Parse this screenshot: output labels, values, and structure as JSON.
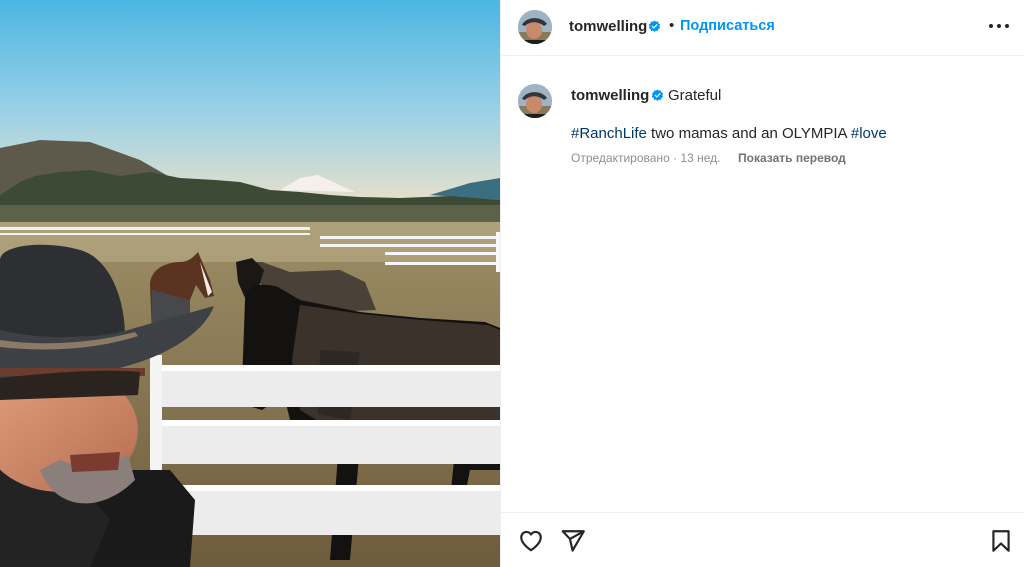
{
  "post": {
    "author": {
      "username": "tomwelling",
      "verified": true,
      "avatar_icon": "profile-avatar"
    },
    "header": {
      "separator": "•",
      "follow_label": "Подписаться",
      "more_icon": "more-horizontal-icon"
    },
    "caption": {
      "username": "tomwelling",
      "lead_text": "Grateful",
      "hashtag_1": "#RanchLife",
      "body_text": " two mamas and an OLYMPIA ",
      "hashtag_2": "#love",
      "meta_text": "Отредактировано · 13 нед.",
      "translate_label": "Показать перевод"
    },
    "actions": {
      "like_icon": "heart-icon",
      "share_icon": "share-icon",
      "save_icon": "bookmark-icon"
    },
    "colors": {
      "follow_blue": "#0095f6",
      "hashtag_blue": "#00376b",
      "verified_blue": "#0095f6",
      "meta_gray": "#8e8e8e"
    }
  }
}
